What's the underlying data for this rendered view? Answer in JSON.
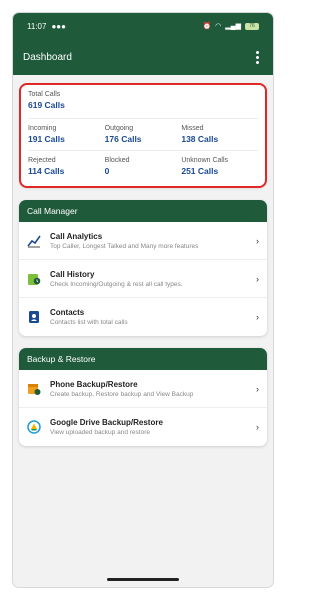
{
  "status_bar": {
    "time": "11:07",
    "battery": "76"
  },
  "app_bar": {
    "title": "Dashboard"
  },
  "stats": {
    "total": {
      "label": "Total Calls",
      "value": "619 Calls"
    },
    "incoming": {
      "label": "Incoming",
      "value": "191 Calls"
    },
    "outgoing": {
      "label": "Outgoing",
      "value": "176 Calls"
    },
    "missed": {
      "label": "Missed",
      "value": "138 Calls"
    },
    "rejected": {
      "label": "Rejected",
      "value": "114 Calls"
    },
    "blocked": {
      "label": "Blocked",
      "value": "0"
    },
    "unknown": {
      "label": "Unknown Calls",
      "value": "251 Calls"
    }
  },
  "call_manager": {
    "header": "Call Manager",
    "items": [
      {
        "title": "Call Analytics",
        "subtitle": "Top Caller, Longest Talked and Many more features",
        "icon": "analytics-chart-icon"
      },
      {
        "title": "Call History",
        "subtitle": "Check Incoming/Outgoing & rest all call types.",
        "icon": "call-history-icon"
      },
      {
        "title": "Contacts",
        "subtitle": "Contacts list with total calls",
        "icon": "contacts-icon"
      }
    ]
  },
  "backup_restore": {
    "header": "Backup & Restore",
    "items": [
      {
        "title": "Phone Backup/Restore",
        "subtitle": "Create backup, Restore backup and View Backup",
        "icon": "phone-backup-icon"
      },
      {
        "title": "Google Drive Backup/Restore",
        "subtitle": "View uploaded backup and restore",
        "icon": "drive-backup-icon"
      }
    ]
  },
  "colors": {
    "primary": "#1f5a3a",
    "accent_value": "#1a4a93",
    "highlight": "#e0282a"
  }
}
